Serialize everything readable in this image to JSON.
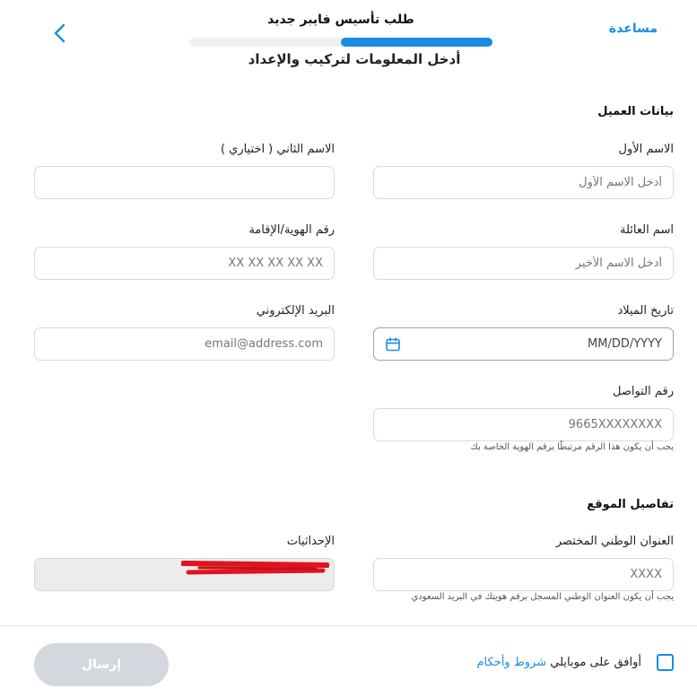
{
  "header": {
    "title": "طلب تأسيس فايبر جديد",
    "subtitle": "أدخل المعلومات لتركيب والإعداد",
    "help": "مساعدة",
    "progress_percent": 50
  },
  "customer": {
    "section_title": "بيانات العميل",
    "first_name": {
      "label": "الاسم الأول",
      "placeholder": "أدخل الاسم الأول"
    },
    "second_name": {
      "label": "الاسم الثاني ( اختياري )",
      "placeholder": ""
    },
    "family_name": {
      "label": "اسم العائلة",
      "placeholder": "أدخل الاسم الأخير"
    },
    "id_number": {
      "label": "رقم الهوية/الإقامة",
      "placeholder": "XX XX XX XX XX"
    },
    "birth_date": {
      "label": "تاريخ الميلاد",
      "placeholder": "MM/DD/YYYY"
    },
    "email": {
      "label": "البريد الإلكتروني",
      "placeholder": "email@address.com"
    },
    "phone": {
      "label": "رقم التواصل",
      "placeholder": "9665XXXXXXXX",
      "hint": "يجب أن يكون هذا الرقم مرتبطًا برقم الهوية الخاصة بك"
    }
  },
  "location": {
    "section_title": "تفاصيل الموقع",
    "short_address": {
      "label": "العنوان الوطني المختصر",
      "placeholder": "XXXX",
      "hint": "يجب أن يكون العنوان الوطني المسجل برقم هويتك في البريد السعودي"
    },
    "coordinates": {
      "label": "الإحداثيات"
    }
  },
  "footer": {
    "agree_prefix": "أوافق على موبايلي",
    "terms_link": "شروط وأحكام",
    "submit": "إرسال"
  },
  "colors": {
    "accent": "#1a8de0",
    "disabled_button": "#d4d7dd",
    "redaction": "#e0141e"
  }
}
